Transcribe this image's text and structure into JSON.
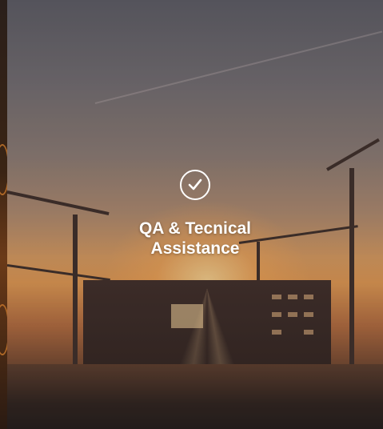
{
  "feature": {
    "title_line1": "QA & Tecnical",
    "title_line2": "Assistance",
    "icon": "check-circle-icon"
  },
  "colors": {
    "title_text": "#ffffff",
    "icon": "#ffffff",
    "sky_top": "#5a5a62",
    "sunset_orange": "#e2984e"
  }
}
